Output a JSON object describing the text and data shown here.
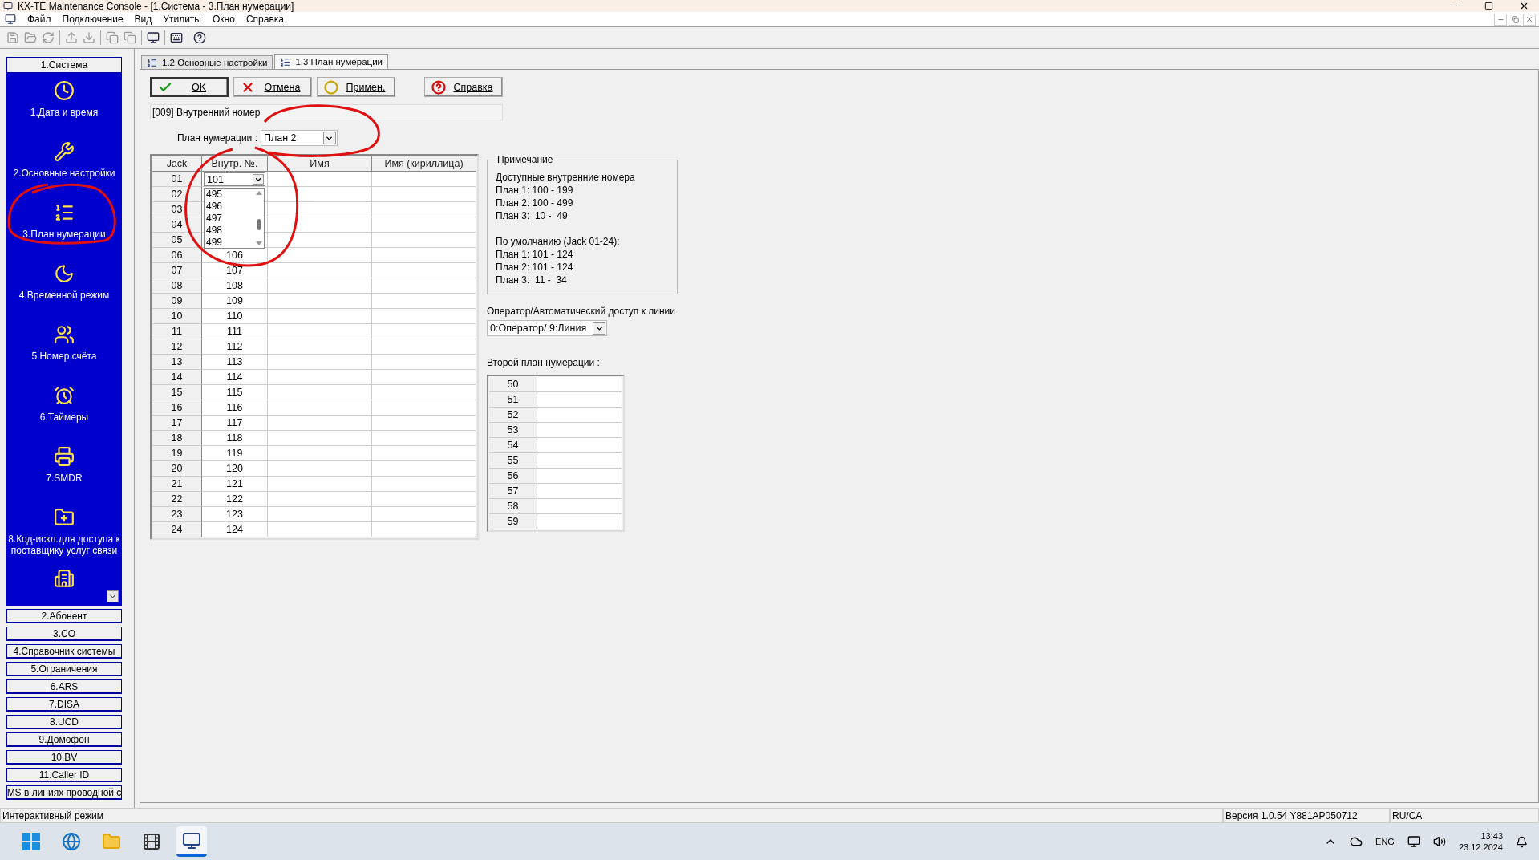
{
  "window": {
    "title": "KX-TE Maintenance Console - [1.Система - 3.План нумерации]"
  },
  "menu": [
    "Файл",
    "Подключение",
    "Вид",
    "Утилиты",
    "Окно",
    "Справка"
  ],
  "sidebar": {
    "header": "1.Система",
    "items": [
      {
        "label": "1.Дата и время"
      },
      {
        "label": "2.Основные настройки"
      },
      {
        "label": "3.План нумерации"
      },
      {
        "label": "4.Временной режим"
      },
      {
        "label": "5.Номер счёта"
      },
      {
        "label": "6.Таймеры"
      },
      {
        "label": "7.SMDR"
      },
      {
        "label": "8.Код-искл.для доступа к поставщику услуг связи"
      }
    ],
    "groups": [
      "2.Абонент",
      "3.CO",
      "4.Справочник системы",
      "5.Ограничения",
      "6.ARS",
      "7.DISA",
      "8.UCD",
      "9.Домофон",
      "10.BV",
      "11.Caller ID",
      "MS в линиях проводной с"
    ]
  },
  "tabs": [
    {
      "label": "1.2 Основные настройки",
      "selected": false
    },
    {
      "label": "1.3 План нумерации",
      "selected": true
    }
  ],
  "buttons": [
    {
      "kind": "ok",
      "label": "OK"
    },
    {
      "kind": "cancel",
      "label": "Отмена"
    },
    {
      "kind": "apply",
      "label": "Примен."
    },
    {
      "kind": "help",
      "label": "Справка"
    }
  ],
  "description": "[009] Внутренний номер",
  "plan": {
    "label": "План нумерации :",
    "value": "План 2"
  },
  "table": {
    "columns": [
      "Jack",
      "Внутр. №.",
      "Имя",
      "Имя (кириллица)"
    ],
    "dropdown": {
      "value": "101",
      "options": [
        "495",
        "496",
        "497",
        "498",
        "499"
      ]
    },
    "rows": [
      {
        "jack": "01"
      },
      {
        "jack": "02"
      },
      {
        "jack": "03"
      },
      {
        "jack": "04"
      },
      {
        "jack": "05"
      },
      {
        "jack": "06",
        "ext": "106"
      },
      {
        "jack": "07",
        "ext": "107"
      },
      {
        "jack": "08",
        "ext": "108"
      },
      {
        "jack": "09",
        "ext": "109"
      },
      {
        "jack": "10",
        "ext": "110"
      },
      {
        "jack": "11",
        "ext": "111"
      },
      {
        "jack": "12",
        "ext": "112"
      },
      {
        "jack": "13",
        "ext": "113"
      },
      {
        "jack": "14",
        "ext": "114"
      },
      {
        "jack": "15",
        "ext": "115"
      },
      {
        "jack": "16",
        "ext": "116"
      },
      {
        "jack": "17",
        "ext": "117"
      },
      {
        "jack": "18",
        "ext": "118"
      },
      {
        "jack": "19",
        "ext": "119"
      },
      {
        "jack": "20",
        "ext": "120"
      },
      {
        "jack": "21",
        "ext": "121"
      },
      {
        "jack": "22",
        "ext": "122"
      },
      {
        "jack": "23",
        "ext": "123"
      },
      {
        "jack": "24",
        "ext": "124"
      }
    ]
  },
  "note": {
    "title": "Примечание",
    "groups": [
      [
        "Доступные внутренние номера",
        "План 1: 100 - 199",
        "План 2: 100 - 499",
        "План 3:  10 -  49"
      ],
      [
        "По умолчанию (Jack 01-24):",
        "План 1: 101 - 124",
        "План 2: 101 - 124",
        "План 3:  11 -  34"
      ]
    ]
  },
  "operator": {
    "label": "Оператор/Автоматический доступ к линии",
    "value": "0:Оператор/ 9:Линия"
  },
  "second_plan": {
    "label": "Второй план нумерации :",
    "rows": [
      "50",
      "51",
      "52",
      "53",
      "54",
      "55",
      "56",
      "57",
      "58",
      "59"
    ]
  },
  "status_bar": [
    "Интерактивный режим",
    "Версия 1.0.54 Y881AP050712",
    "RU/CA"
  ],
  "taskbar": {
    "language": "ENG",
    "time": "13:43",
    "date": "23.12.2024"
  }
}
